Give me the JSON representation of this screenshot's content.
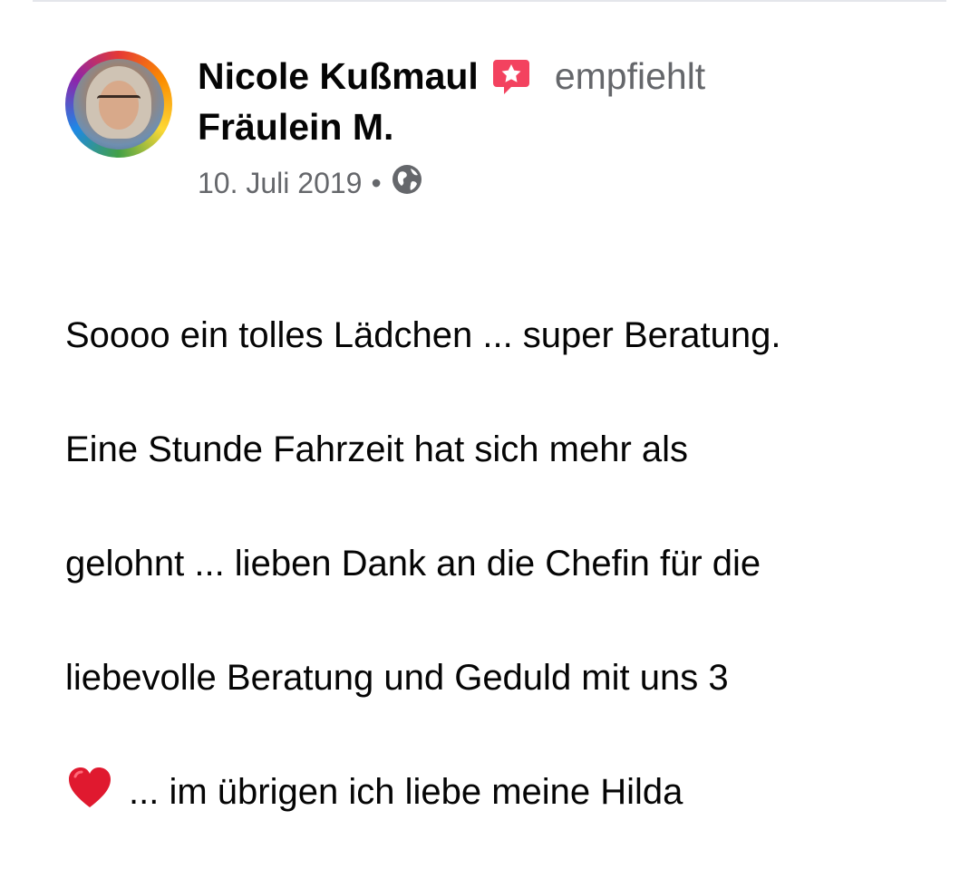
{
  "post": {
    "author": "Nicole Kußmaul",
    "action": "empfiehlt",
    "page": "Fräulein M.",
    "date": "10. Juli 2019",
    "separator": "•",
    "privacy_icon": "globe-icon",
    "recommend_icon": "recommend-star-icon",
    "text_lines": [
      "Soooo ein tolles Lädchen ... super Beratung.",
      "Eine Stunde Fahrzeit hat sich mehr als",
      "gelohnt ... lieben Dank an die Chefin für die",
      "liebevolle Beratung und Geduld mit uns 3"
    ],
    "last_line_text": "... im übrigen ich liebe meine Hilda",
    "emoji": "heart-icon"
  },
  "colors": {
    "recommend_red": "#f3425f",
    "secondary_text": "#65676b",
    "primary_text": "#050505"
  }
}
